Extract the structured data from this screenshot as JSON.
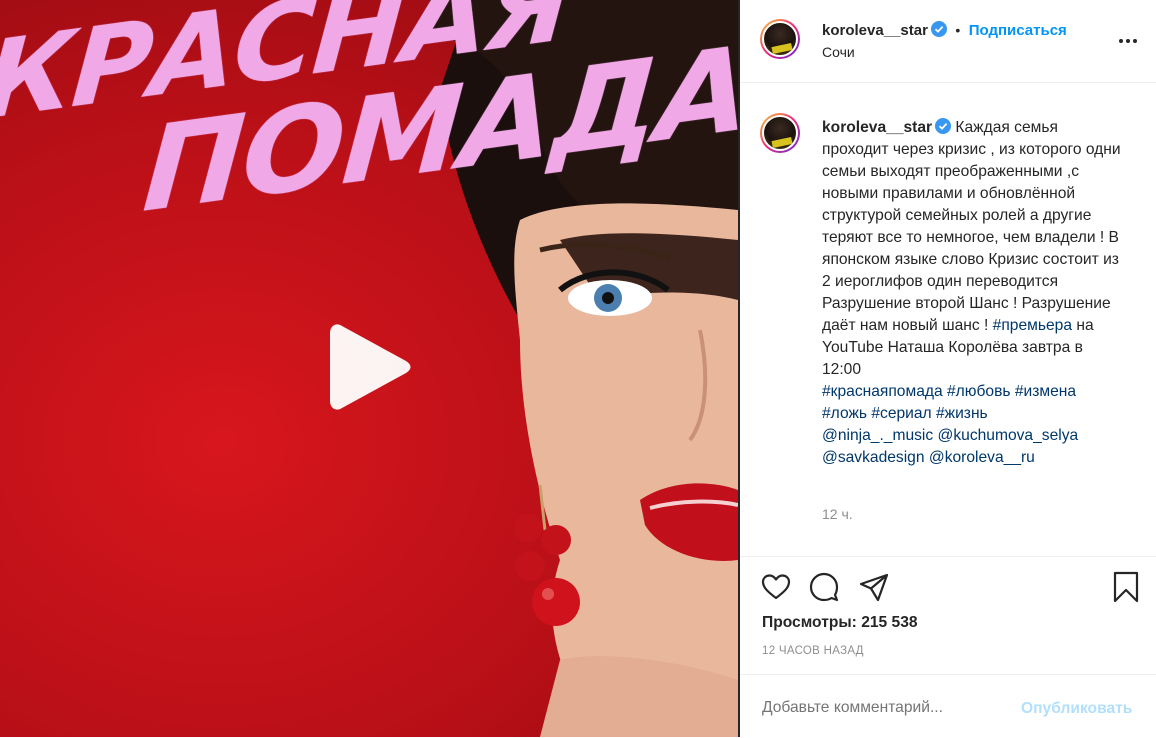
{
  "media": {
    "title_line1": "КРАСНАЯ",
    "title_line2": "ПОМАДА",
    "play_icon": "play-icon"
  },
  "header": {
    "username": "koroleva__star",
    "separator": "•",
    "follow_label": "Подписаться",
    "location": "Сочи",
    "more_icon": "more-horizontal-icon"
  },
  "caption": {
    "username": "koroleva__star",
    "text_before_tag": " Каждая семья проходит через кризис , из которого одни семьи выходят преображенными ,с новыми правилами и обновлённой структурой семейных ролей а другие теряют все то немногое, чем владели ! В японском языке слово Кризис состоит из 2 иероглифов один переводится Разрушение второй Шанс ! Разрушение даёт нам новый шанс ! ",
    "tag_premiere": "#премьера",
    "text_after_tag": " на YouTube Наташа Королёва завтра в 12:00",
    "tag1": "#краснаяпомада",
    "tag2": "#любовь",
    "tag3": "#измена",
    "tag4": "#ложь",
    "tag5": "#сериал",
    "tag6": "#жизнь",
    "mention1": "@ninja_._music",
    "mention2": "@kuchumova_selya",
    "mention3": "@savkadesign",
    "mention4": "@koroleva__ru",
    "time": "12 ч."
  },
  "actions": {
    "like_icon": "heart-icon",
    "comment_icon": "comment-icon",
    "share_icon": "share-icon",
    "save_icon": "bookmark-icon"
  },
  "stats": {
    "views_label": "Просмотры: ",
    "views_value": "215 538",
    "posted_ago": "12 ЧАСОВ НАЗАД"
  },
  "comment": {
    "placeholder": "Добавьте комментарий...",
    "post_label": "Опубликовать"
  },
  "colors": {
    "accent": "#0095f6",
    "hashtag": "#00376b",
    "post_disabled": "#b2dffc",
    "media_red": "#c4121a",
    "title_pink": "#f0a8e6"
  }
}
